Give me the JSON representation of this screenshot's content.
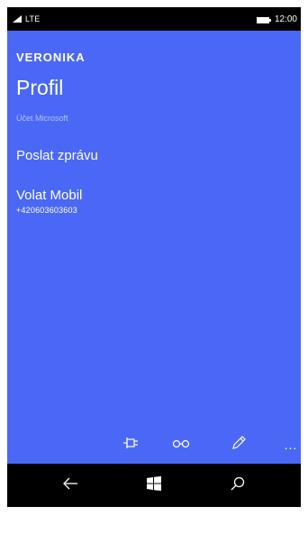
{
  "status_bar": {
    "network": "LTE",
    "time": "12:00",
    "signal_icon": "signal-icon",
    "battery_icon": "battery-icon"
  },
  "contact": {
    "name": "VERONIKA",
    "page_title": "Profil",
    "account_label": "Účet Microsoft"
  },
  "actions": {
    "send_message": "Poslat zprávu",
    "call": {
      "label": "Volat Mobil",
      "number": "+420603603603"
    }
  },
  "app_bar": {
    "pin_icon": "pin-icon",
    "link_icon": "link-icon",
    "edit_icon": "pencil-icon",
    "more_label": "..."
  },
  "nav_bar": {
    "back_icon": "back-arrow-icon",
    "start_icon": "windows-start-icon",
    "search_icon": "search-icon"
  },
  "colors": {
    "accent": "#4a68f5",
    "background": "#000000",
    "text": "#ffffff"
  }
}
